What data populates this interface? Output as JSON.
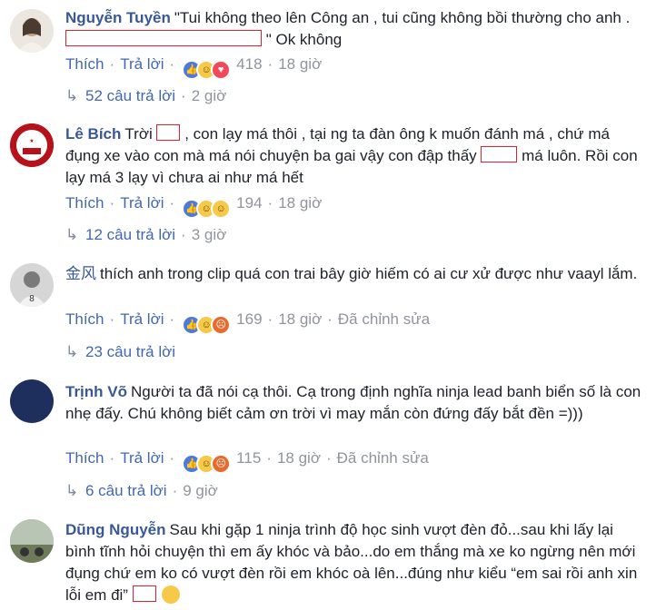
{
  "comments": [
    {
      "author": "Nguyễn Tuyền",
      "text_a": "\"Tui không theo lên Công an , tui cũng không bồi thường cho anh . ",
      "text_b": " \" Ok không",
      "like_label": "Thích",
      "reply_label": "Trả lời",
      "reaction_count": "418",
      "time": "18 giờ",
      "replies_label": "52 câu trả lời",
      "replies_time": "2 giờ"
    },
    {
      "author": "Lê Bích",
      "text_a": "Trời ",
      "text_b": " , con lạy má thôi , tại ng ta đàn ông k muốn đánh má , chứ má đụng xe vào con mà má nói chuyện ba gai vậy con đập thấy ",
      "text_c": " má luôn. Rồi con lạy má 3 lạy vì chưa ai như má hết",
      "like_label": "Thích",
      "reply_label": "Trả lời",
      "reaction_count": "194",
      "time": "18 giờ",
      "replies_label": "12 câu trả lời",
      "replies_time": "3 giờ"
    },
    {
      "author": "金风",
      "text": "thích anh trong clip quá con trai bây giờ hiếm có ai cư xử được như vaayl lắm.",
      "like_label": "Thích",
      "reply_label": "Trả lời",
      "reaction_count": "169",
      "time": "18 giờ",
      "edited": "Đã chỉnh sửa",
      "replies_label": "23 câu trả lời"
    },
    {
      "author": "Trịnh Võ",
      "text": "Người ta đã nói cạ thôi. Cạ trong định nghĩa ninja lead banh biển số là con nhẹ đấy. Chú không biết cảm ơn trời vì may mắn còn đứng đấy bắt đền =)))",
      "like_label": "Thích",
      "reply_label": "Trả lời",
      "reaction_count": "115",
      "time": "18 giờ",
      "edited": "Đã chỉnh sửa",
      "replies_label": "6 câu trả lời",
      "replies_time": "9 giờ"
    },
    {
      "author": "Dũng Nguyễn",
      "text_a": "Sau khi gặp 1 ninja trình độ học sinh vượt đèn đỏ...sau khi lấy lại bình tĩnh hỏi chuyện thì em ấy khóc và bảo...do em thắng mà xe ko ngừng nên mới đụng chứ em ko có vượt đèn rồi em khóc oà lên...đúng như kiểu “em sai rồi anh xin lỗi em đi” "
    }
  ],
  "separator": "·",
  "colors": {
    "link": "#385898",
    "meta": "#90949c",
    "redaction": "#e0202a"
  }
}
